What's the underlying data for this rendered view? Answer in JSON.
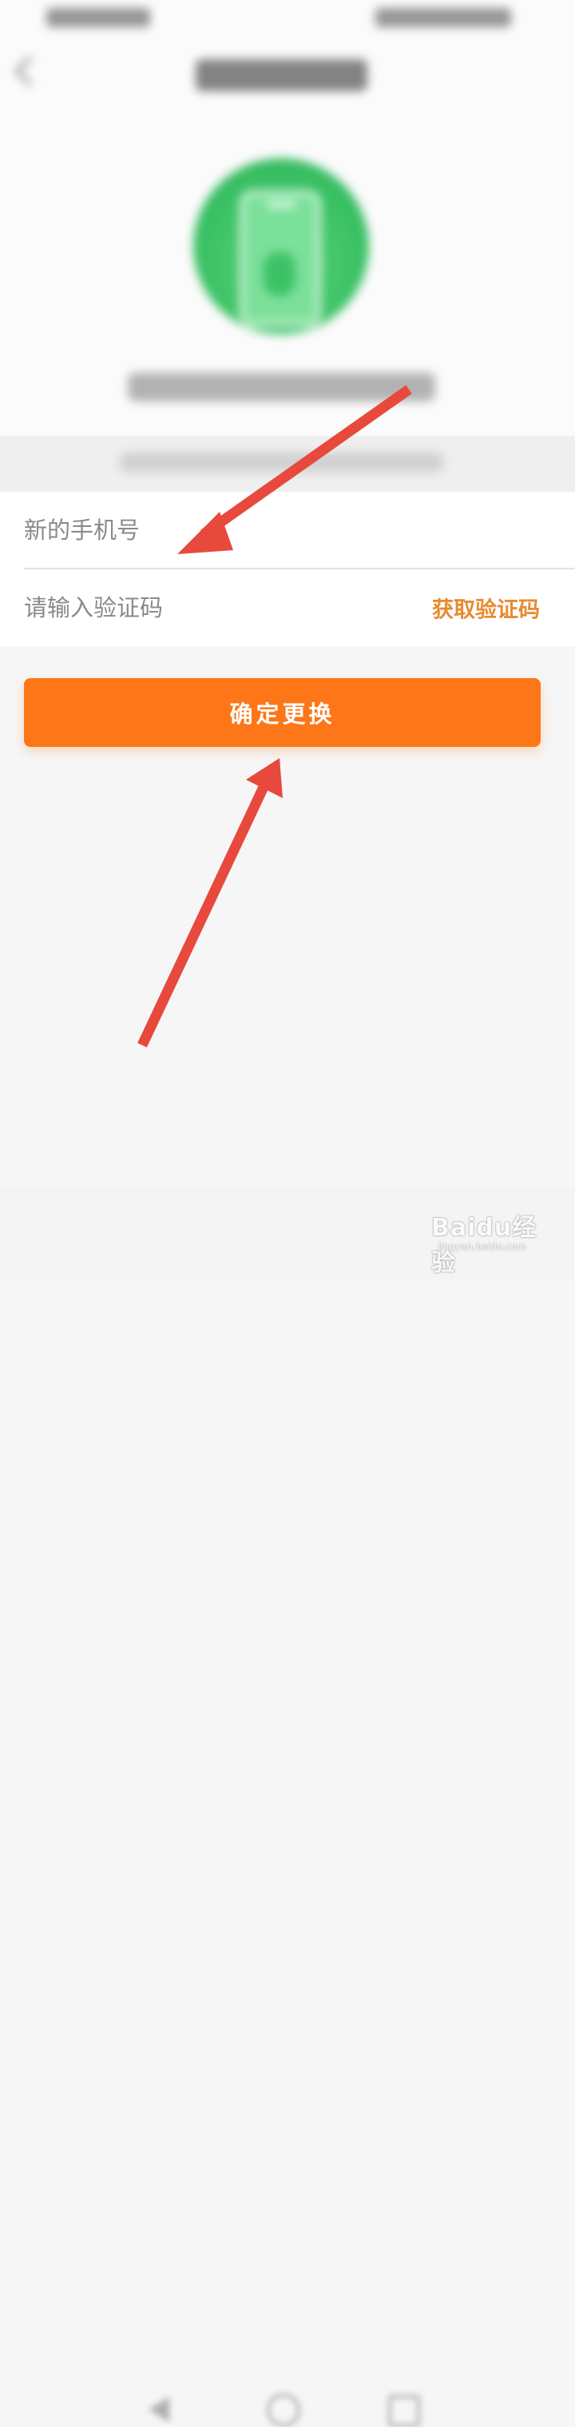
{
  "form": {
    "phone_placeholder": "新的手机号",
    "code_placeholder": "请输入验证码",
    "get_code_label": "获取验证码"
  },
  "actions": {
    "confirm_label": "确定更换"
  },
  "watermark": {
    "logo_text": "Baidu经验",
    "site": "jingyan.baidu.com"
  },
  "colors": {
    "accent": "#fd7617",
    "link": "#e98a2f",
    "arrow": "#e8493d",
    "icon_green": "#3cc266"
  },
  "icons": {
    "header": [
      "back-chevron-icon",
      "phone-illustration-icon"
    ],
    "nav": [
      "nav-back-icon",
      "nav-home-icon",
      "nav-recent-icon"
    ]
  }
}
